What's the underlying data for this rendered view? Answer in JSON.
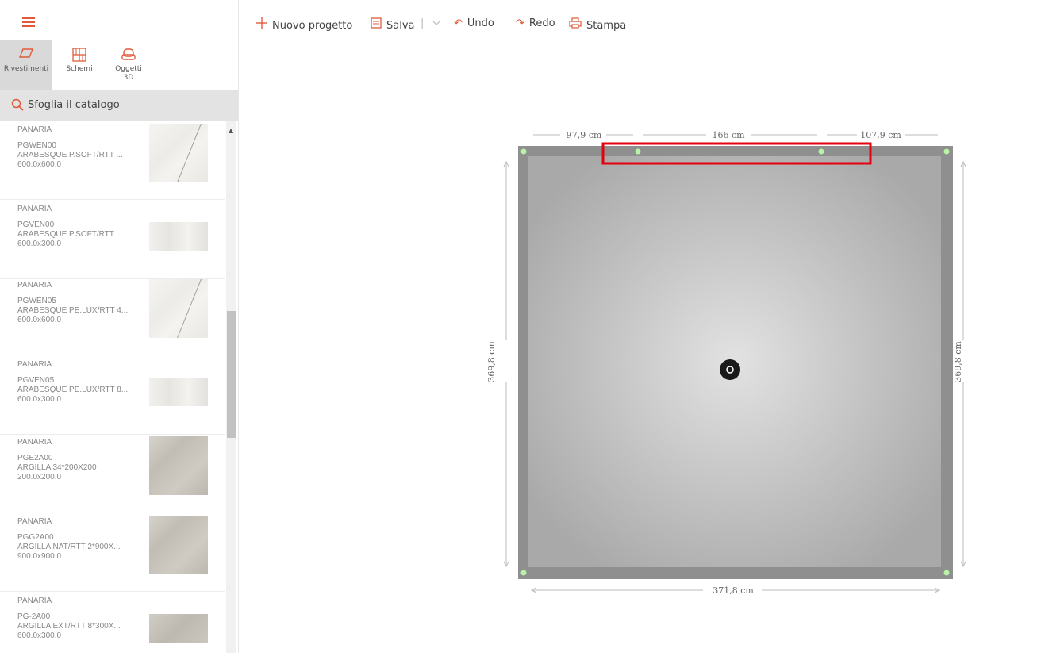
{
  "toolbar": {
    "new_project": "Nuovo progetto",
    "save": "Salva",
    "undo": "Undo",
    "redo": "Redo",
    "print": "Stampa"
  },
  "tabs": [
    {
      "label": "Rivestimenti"
    },
    {
      "label": "Schemi"
    },
    {
      "label": "Oggetti",
      "label2": "3D"
    }
  ],
  "search": {
    "label": "Sfoglia il catalogo"
  },
  "catalog": [
    {
      "brand": "PANARIA",
      "code": "PGWEN00",
      "name": "ARABESQUE P.SOFT/RTT ...",
      "size": "600.0x600.0"
    },
    {
      "brand": "PANARIA",
      "code": "PGVEN00",
      "name": "ARABESQUE P.SOFT/RTT ...",
      "size": "600.0x300.0"
    },
    {
      "brand": "PANARIA",
      "code": "PGWEN05",
      "name": "ARABESQUE PE.LUX/RTT 4...",
      "size": "600.0x600.0"
    },
    {
      "brand": "PANARIA",
      "code": "PGVEN05",
      "name": "ARABESQUE PE.LUX/RTT 8...",
      "size": "600.0x300.0"
    },
    {
      "brand": "PANARIA",
      "code": "PGE2A00",
      "name": "ARGILLA 34*200X200",
      "size": "200.0x200.0"
    },
    {
      "brand": "PANARIA",
      "code": "PGG2A00",
      "name": "ARGILLA NAT/RTT 2*900X...",
      "size": "900.0x900.0"
    },
    {
      "brand": "PANARIA",
      "code": "PG-2A00",
      "name": "ARGILLA EXT/RTT 8*300X...",
      "size": "600.0x300.0"
    }
  ],
  "dimensions": {
    "top_left": "97,9 cm",
    "top_mid": "166 cm",
    "top_right": "107,9 cm",
    "bottom": "371,8 cm",
    "left": "369,8 cm",
    "right": "369,8 cm"
  },
  "colors": {
    "accent": "#e05a3a",
    "highlight": "#e3000f"
  }
}
